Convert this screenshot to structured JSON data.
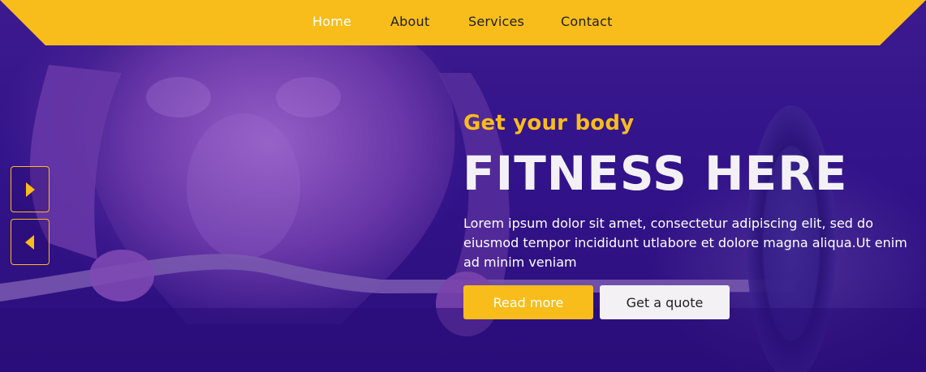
{
  "nav": {
    "items": [
      {
        "label": "Home",
        "active": true
      },
      {
        "label": "About",
        "active": false
      },
      {
        "label": "Services",
        "active": false
      },
      {
        "label": "Contact",
        "active": false
      }
    ]
  },
  "hero": {
    "subtitle": "Get your body",
    "title": "FITNESS HERE",
    "description": "Lorem ipsum dolor sit amet, consectetur adipiscing elit, sed do eiusmod tempor incididunt utlabore et dolore magna aliqua.Ut enim ad minim veniam",
    "read_more_label": "Read more",
    "quote_label": "Get a quote"
  },
  "slider": {
    "next_icon": "play-right-icon",
    "prev_icon": "play-left-icon"
  },
  "colors": {
    "accent": "#f8bd1b",
    "background": "#2c0f7c",
    "title": "#f4f1f6",
    "quote_button": "#f3f1f3"
  }
}
